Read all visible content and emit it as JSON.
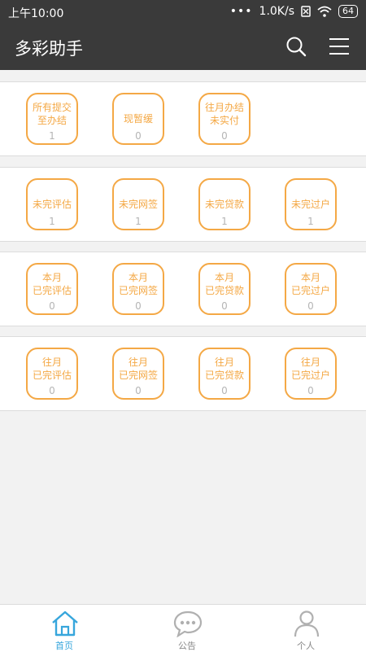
{
  "status_bar": {
    "time": "上午10:00",
    "network_speed": "1.0K/s",
    "battery": "64"
  },
  "app_bar": {
    "title": "多彩助手",
    "search_icon": "search-icon",
    "menu_icon": "menu-icon"
  },
  "sections": [
    {
      "tiles": [
        {
          "label": "所有提交\n至办结",
          "count": "1"
        },
        {
          "label": "现暂缓",
          "count": "0"
        },
        {
          "label": "往月办结\n未实付",
          "count": "0"
        }
      ]
    },
    {
      "tiles": [
        {
          "label": "未完评估",
          "count": "1"
        },
        {
          "label": "未完网签",
          "count": "1"
        },
        {
          "label": "未完贷款",
          "count": "1"
        },
        {
          "label": "未完过户",
          "count": "1"
        }
      ]
    },
    {
      "tiles": [
        {
          "label": "本月\n已完评估",
          "count": "0"
        },
        {
          "label": "本月\n已完网签",
          "count": "0"
        },
        {
          "label": "本月\n已完贷款",
          "count": "0"
        },
        {
          "label": "本月\n已完过户",
          "count": "0"
        }
      ]
    },
    {
      "tiles": [
        {
          "label": "往月\n已完评估",
          "count": "0"
        },
        {
          "label": "往月\n已完网签",
          "count": "0"
        },
        {
          "label": "往月\n已完贷款",
          "count": "0"
        },
        {
          "label": "往月\n已完过户",
          "count": "0"
        }
      ]
    }
  ],
  "tab_bar": {
    "items": [
      {
        "label": "首页",
        "icon": "home-icon",
        "active": true
      },
      {
        "label": "公告",
        "icon": "chat-bubble-icon",
        "active": false
      },
      {
        "label": "个人",
        "icon": "person-icon",
        "active": false
      }
    ]
  },
  "colors": {
    "accent": "#f4a845",
    "active_tab": "#37a6dc",
    "bar": "#3a3a3a"
  }
}
